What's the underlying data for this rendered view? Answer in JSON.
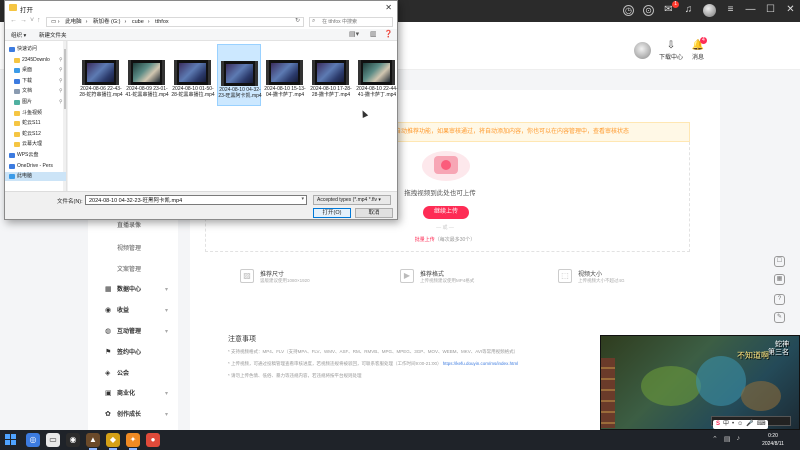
{
  "site": {
    "header": {
      "upload_label": "下载中心",
      "notify_label": "消息",
      "notify_count": "4"
    },
    "sidebar": {
      "sub_items": [
        "直播录像",
        "视频管理",
        "文案管理"
      ],
      "groups": [
        {
          "label": "数据中心",
          "icon": "chart-icon"
        },
        {
          "label": "收益",
          "icon": "coin-icon"
        },
        {
          "label": "互动管理",
          "icon": "chat-icon"
        },
        {
          "label": "签约中心",
          "icon": "flag-icon"
        },
        {
          "label": "公会",
          "icon": "guild-icon"
        },
        {
          "label": "商业化",
          "icon": "bag-icon"
        },
        {
          "label": "创作成长",
          "icon": "growth-icon"
        }
      ]
    },
    "upload": {
      "notice": "已开启自动推荐功能，如果审核通过，将自动添加内容，你也可以在内容管理中，查看审核状态",
      "drag_hint": "拖拽视频到此处也可上传",
      "button": "继续上传",
      "or": "或",
      "batch_link": "批量上传",
      "batch_note": "（每次最多30个）",
      "features": [
        {
          "title": "推荐尺寸",
          "desc": "竖版建议使用1080×1920",
          "icon": "image-icon"
        },
        {
          "title": "推荐格式",
          "desc": "上传视频建议使用MP4格式",
          "icon": "video-icon"
        },
        {
          "title": "视频大小",
          "desc": "上传视频大小不超过4G",
          "icon": "size-icon"
        }
      ]
    },
    "notes": {
      "title": "注意事项",
      "lines": [
        "* 支持视频格式：MP4、FLV（支持MPA、FLV、WMV、ASF、RM、RMVB、MPG、MPEG、3GP、MOV、WEBM、MKV、AVI等常用视频格式）",
        "* 上传视频，可通过投稿管理查看审核进度，若视频违规将被驳回，可联系客服处理（工作时间9:00-21:00）",
        "* 请勿上传色情、低俗、暴力等违规内容，若违规将按平台规则处理"
      ],
      "link": "https://kefu.douyin.com/ms/index.html"
    }
  },
  "game_overlay": {
    "title": "蛇神",
    "subtitle": "第三名",
    "text": "不知道啊"
  },
  "dialog": {
    "title": "打开",
    "address": [
      "此电脑",
      "新加卷 (G:)",
      "cube",
      "tthfox"
    ],
    "search_placeholder": "在 tthfox 中搜索",
    "organize": "组织 ▾",
    "new_folder": "新建文件夹",
    "nav_items": [
      {
        "label": "快速访问",
        "icon": "star-icon",
        "color": "#3c7be0",
        "indent": 0,
        "pin": false
      },
      {
        "label": "2345Downlo",
        "icon": "folder-icon",
        "color": "#f5c542",
        "indent": 1,
        "pin": true
      },
      {
        "label": "桌面",
        "icon": "desktop-icon",
        "color": "#3c9be8",
        "indent": 1,
        "pin": true
      },
      {
        "label": "下载",
        "icon": "download-icon",
        "color": "#3c7be0",
        "indent": 1,
        "pin": true
      },
      {
        "label": "文档",
        "icon": "document-icon",
        "color": "#8a9bb0",
        "indent": 1,
        "pin": true
      },
      {
        "label": "图片",
        "icon": "picture-icon",
        "color": "#4fb0a0",
        "indent": 1,
        "pin": true
      },
      {
        "label": "斗鱼视频",
        "icon": "folder-icon",
        "color": "#f5c542",
        "indent": 1,
        "pin": false
      },
      {
        "label": "蛇云S11",
        "icon": "folder-icon",
        "color": "#f5c542",
        "indent": 1,
        "pin": false
      },
      {
        "label": "蛇云S12",
        "icon": "folder-icon",
        "color": "#f5c542",
        "indent": 1,
        "pin": false
      },
      {
        "label": "云幕大理",
        "icon": "folder-icon",
        "color": "#f5c542",
        "indent": 1,
        "pin": false
      },
      {
        "label": "WPS云盘",
        "icon": "cloud-icon",
        "color": "#3c7be0",
        "indent": 0,
        "pin": false
      },
      {
        "label": "OneDrive - Pers",
        "icon": "onedrive-icon",
        "color": "#3c7be0",
        "indent": 0,
        "pin": false
      },
      {
        "label": "此电脑",
        "icon": "computer-icon",
        "color": "#3c9be8",
        "indent": 0,
        "pin": false,
        "selected": true
      }
    ],
    "files": [
      {
        "name": "2024-08-06 22-43-28-蛇符串播拉.mp4",
        "variant": "a",
        "selected": false
      },
      {
        "name": "2024-08-09 23-01-41-蛇黑串播拉.mp4",
        "variant": "b",
        "selected": false
      },
      {
        "name": "2024-08-10 01-50-28-蛇黑串播拉.mp4",
        "variant": "a",
        "selected": false
      },
      {
        "name": "2024-08-10 04-32-23-旺黑阿卡凯.mp4",
        "variant": "a",
        "selected": true
      },
      {
        "name": "2024-08-10 15-13-04-撒卡萨丁.mp4",
        "variant": "a",
        "selected": false
      },
      {
        "name": "2024-08-10 17-28-28-撒卡萨丁.mp4",
        "variant": "a",
        "selected": false
      },
      {
        "name": "2024-08-10 22-44-41-撒卡萨丁.mp4",
        "variant": "b",
        "selected": false
      }
    ],
    "filename_label": "文件名(N):",
    "filename_value": "2024-08-10 04-32-23-旺黑阿卡凯.mp4",
    "filetype": "Accepted types (*.mp4 *.flv",
    "open_button": "打开(O)",
    "cancel_button": "取消"
  },
  "taskbar": {
    "clock_time": "0:20",
    "clock_date": "2024/8/11",
    "ime": [
      "S",
      "中",
      "•",
      "☺",
      "🎤",
      "⌨"
    ]
  }
}
